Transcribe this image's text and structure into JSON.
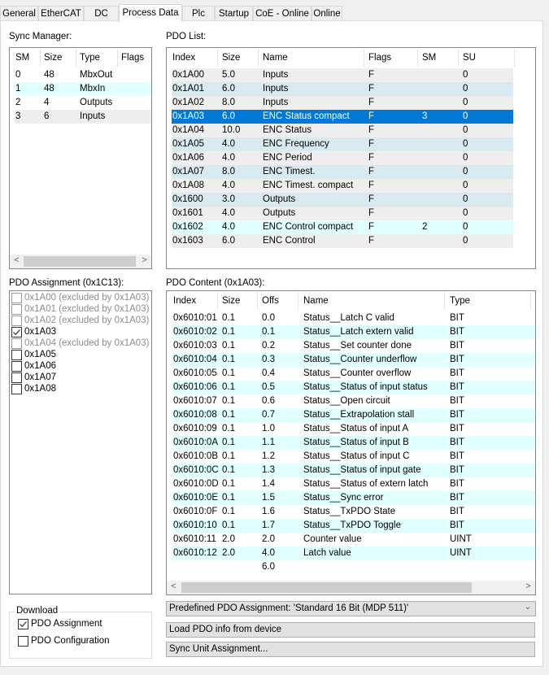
{
  "tabs": [
    {
      "label": "General"
    },
    {
      "label": "EtherCAT"
    },
    {
      "label": "DC"
    },
    {
      "label": "Process Data",
      "active": true
    },
    {
      "label": "Plc"
    },
    {
      "label": "Startup"
    },
    {
      "label": "CoE - Online"
    },
    {
      "label": "Online"
    }
  ],
  "sync_manager": {
    "title": "Sync Manager:",
    "columns": [
      "SM",
      "Size",
      "Type",
      "Flags"
    ],
    "rows": [
      [
        "0",
        "48",
        "MbxOut",
        ""
      ],
      [
        "1",
        "48",
        "MbxIn",
        ""
      ],
      [
        "2",
        "4",
        "Outputs",
        ""
      ],
      [
        "3",
        "6",
        "Inputs",
        ""
      ]
    ]
  },
  "pdo_list": {
    "title": "PDO List:",
    "columns": [
      "Index",
      "Size",
      "Name",
      "Flags",
      "SM",
      "SU"
    ],
    "selected_index": 3,
    "rows": [
      [
        "0x1A00",
        "5.0",
        "Inputs",
        "F",
        "",
        "0"
      ],
      [
        "0x1A01",
        "6.0",
        "Inputs",
        "F",
        "",
        "0"
      ],
      [
        "0x1A02",
        "8.0",
        "Inputs",
        "F",
        "",
        "0"
      ],
      [
        "0x1A03",
        "6.0",
        "ENC Status compact",
        "F",
        "3",
        "0"
      ],
      [
        "0x1A04",
        "10.0",
        "ENC Status",
        "F",
        "",
        "0"
      ],
      [
        "0x1A05",
        "4.0",
        "ENC Frequency",
        "F",
        "",
        "0"
      ],
      [
        "0x1A06",
        "4.0",
        "ENC Period",
        "F",
        "",
        "0"
      ],
      [
        "0x1A07",
        "8.0",
        "ENC Timest.",
        "F",
        "",
        "0"
      ],
      [
        "0x1A08",
        "4.0",
        "ENC Timest. compact",
        "F",
        "",
        "0"
      ],
      [
        "0x1600",
        "3.0",
        "Outputs",
        "F",
        "",
        "0"
      ],
      [
        "0x1601",
        "4.0",
        "Outputs",
        "F",
        "",
        "0"
      ],
      [
        "0x1602",
        "4.0",
        "ENC Control compact",
        "F",
        "2",
        "0"
      ],
      [
        "0x1603",
        "6.0",
        "ENC Control",
        "F",
        "",
        "0"
      ]
    ]
  },
  "pdo_assignment": {
    "title": "PDO Assignment (0x1C13):",
    "items": [
      {
        "label": "0x1A00 (excluded by 0x1A03)",
        "checked": false,
        "disabled": true
      },
      {
        "label": "0x1A01 (excluded by 0x1A03)",
        "checked": false,
        "disabled": true
      },
      {
        "label": "0x1A02 (excluded by 0x1A03)",
        "checked": false,
        "disabled": true
      },
      {
        "label": "0x1A03",
        "checked": true,
        "disabled": false
      },
      {
        "label": "0x1A04 (excluded by 0x1A03)",
        "checked": false,
        "disabled": true
      },
      {
        "label": "0x1A05",
        "checked": false,
        "disabled": false
      },
      {
        "label": "0x1A06",
        "checked": false,
        "disabled": false
      },
      {
        "label": "0x1A07",
        "checked": false,
        "disabled": false
      },
      {
        "label": "0x1A08",
        "checked": false,
        "disabled": false
      }
    ]
  },
  "pdo_content": {
    "title": "PDO Content (0x1A03):",
    "columns": [
      "Index",
      "Size",
      "Offs",
      "Name",
      "Type"
    ],
    "rows": [
      [
        "0x6010:01",
        "0.1",
        "0.0",
        "Status__Latch C valid",
        "BIT"
      ],
      [
        "0x6010:02",
        "0.1",
        "0.1",
        "Status__Latch extern valid",
        "BIT"
      ],
      [
        "0x6010:03",
        "0.1",
        "0.2",
        "Status__Set counter done",
        "BIT"
      ],
      [
        "0x6010:04",
        "0.1",
        "0.3",
        "Status__Counter underflow",
        "BIT"
      ],
      [
        "0x6010:05",
        "0.1",
        "0.4",
        "Status__Counter overflow",
        "BIT"
      ],
      [
        "0x6010:06",
        "0.1",
        "0.5",
        "Status__Status of input status",
        "BIT"
      ],
      [
        "0x6010:07",
        "0.1",
        "0.6",
        "Status__Open circuit",
        "BIT"
      ],
      [
        "0x6010:08",
        "0.1",
        "0.7",
        "Status__Extrapolation stall",
        "BIT"
      ],
      [
        "0x6010:09",
        "0.1",
        "1.0",
        "Status__Status of input A",
        "BIT"
      ],
      [
        "0x6010:0A",
        "0.1",
        "1.1",
        "Status__Status of input B",
        "BIT"
      ],
      [
        "0x6010:0B",
        "0.1",
        "1.2",
        "Status__Status of input C",
        "BIT"
      ],
      [
        "0x6010:0C",
        "0.1",
        "1.3",
        "Status__Status of input gate",
        "BIT"
      ],
      [
        "0x6010:0D",
        "0.1",
        "1.4",
        "Status__Status of extern latch",
        "BIT"
      ],
      [
        "0x6010:0E",
        "0.1",
        "1.5",
        "Status__Sync error",
        "BIT"
      ],
      [
        "0x6010:0F",
        "0.1",
        "1.6",
        "Status__TxPDO State",
        "BIT"
      ],
      [
        "0x6010:10",
        "0.1",
        "1.7",
        "Status__TxPDO Toggle",
        "BIT"
      ],
      [
        "0x6010:11",
        "2.0",
        "2.0",
        "Counter value",
        "UINT"
      ],
      [
        "0x6010:12",
        "2.0",
        "4.0",
        "Latch value",
        "UINT"
      ],
      [
        "",
        "",
        "6.0",
        "",
        ""
      ]
    ]
  },
  "download": {
    "title": "Download",
    "pdo_assignment": {
      "label": "PDO Assignment",
      "checked": true
    },
    "pdo_configuration": {
      "label": "PDO Configuration",
      "checked": false
    }
  },
  "predefined_combo": {
    "value": "Predefined PDO Assignment: 'Standard 16 Bit (MDP 511)'"
  },
  "buttons": {
    "load_pdo": "Load PDO info from device",
    "sync_unit": "Sync Unit Assignment..."
  },
  "scroll_arrows": {
    "left": "<",
    "right": ">"
  },
  "colors": {
    "selection": "#0078d7",
    "row_gray": "#eeeeee",
    "row_teal": "#d8eaf0",
    "row_cyan": "#e0ffff",
    "disabled_text": "#8c8c8c"
  }
}
